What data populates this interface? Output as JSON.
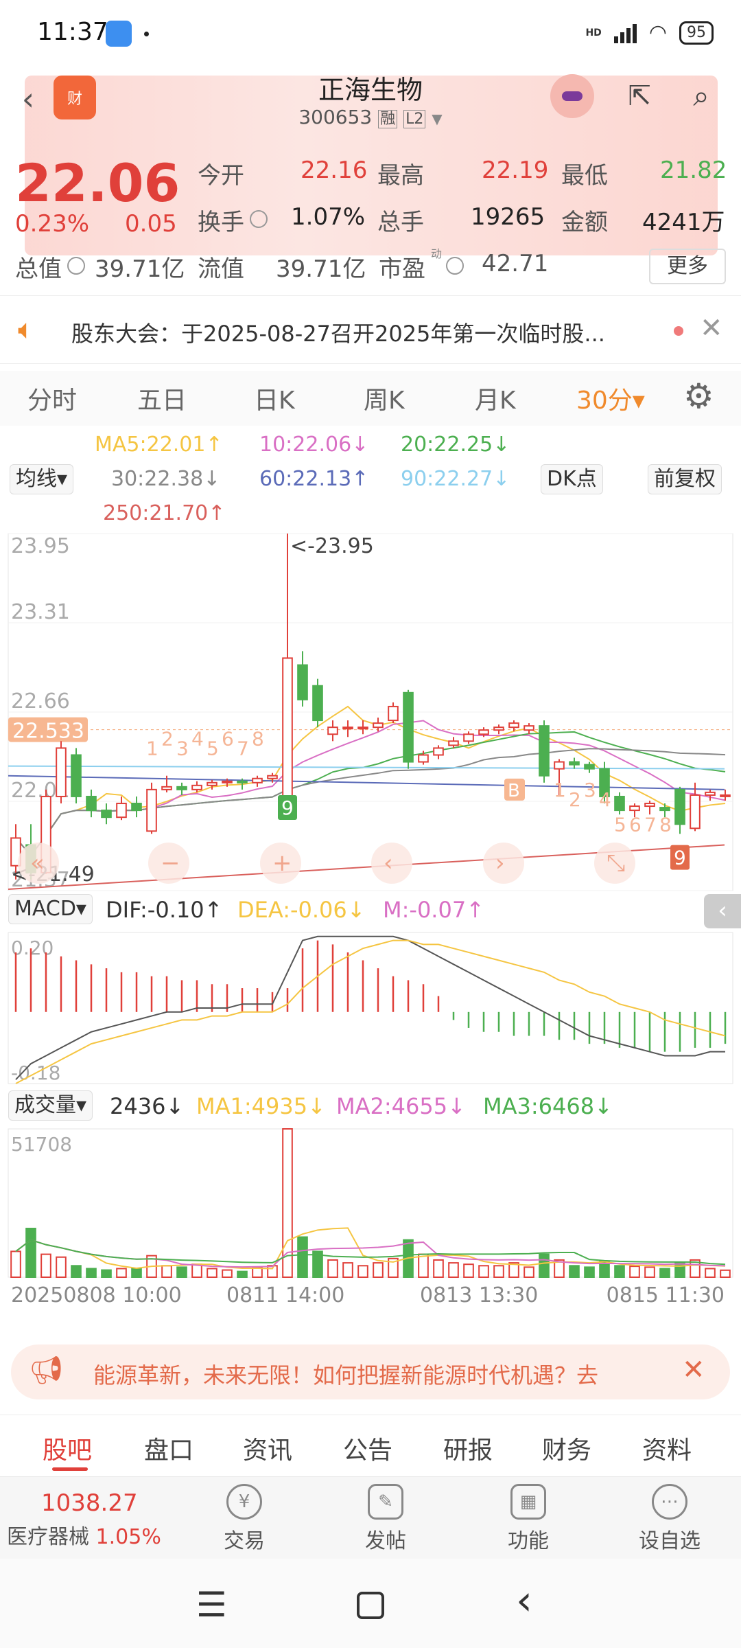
{
  "status": {
    "time": "11:37",
    "battery": "95",
    "network": "HD"
  },
  "header": {
    "title": "正海生物",
    "code": "300653",
    "tag1": "融",
    "tag2": "L2"
  },
  "quote": {
    "price": "22.06",
    "pct": "0.23%",
    "chg": "0.05",
    "open_label": "今开",
    "open": "22.16",
    "high_label": "最高",
    "high": "22.19",
    "low_label": "最低",
    "low": "21.82",
    "turnover_label": "换手",
    "turnover": "1.07%",
    "volume_label": "总手",
    "volume": "19265",
    "amount_label": "金额",
    "amount": "4241万",
    "mktcap_label": "总值",
    "mktcap": "39.71亿",
    "float_label": "流值",
    "float": "39.71亿",
    "pe_label": "市盈",
    "pe_sup": "动",
    "pe": "42.71",
    "more": "更多"
  },
  "notice": {
    "text": "股东大会：于2025-08-27召开2025年第一次临时股..."
  },
  "tabs": [
    {
      "label": "分时"
    },
    {
      "label": "五日"
    },
    {
      "label": "日K"
    },
    {
      "label": "周K"
    },
    {
      "label": "月K"
    },
    {
      "label": "30分▾"
    }
  ],
  "legend": {
    "selector": "均线▾",
    "ma5": "MA5:22.01↑",
    "ma10": "10:22.06↓",
    "ma20": "20:22.25↓",
    "ma30": "30:22.38↓",
    "ma60": "60:22.13↑",
    "ma90": "90:22.27↓",
    "ma250": "250:21.70↑",
    "dk": "DK点",
    "fq": "前复权"
  },
  "colors": {
    "up": "#e0403a",
    "down": "#4caf50",
    "accent": "#f08a2c",
    "ma5": "#f5c542",
    "ma10": "#d96fc4",
    "ma20": "#4caf50",
    "ma30": "#888888",
    "ma60": "#5b6bb8",
    "ma90": "#8ccfee",
    "ma250": "#d9605c"
  },
  "kline": {
    "y_labels": [
      "23.95",
      "23.31",
      "22.66",
      "22.01",
      "21.37"
    ],
    "ylim": [
      21.37,
      23.95
    ],
    "current_price_tag": "22.533",
    "max_label": "<-23.95",
    "min_label": "<-21.49",
    "markers": {
      "b": "B",
      "nine_a": "9",
      "nine_b": "9"
    },
    "seq_a": [
      "1",
      "2",
      "3",
      "4",
      "5",
      "6",
      "7",
      "8"
    ],
    "seq_b": [
      "1",
      "2",
      "3",
      "4",
      "5",
      "6",
      "7",
      "8"
    ],
    "candles": [
      [
        21.55,
        21.75,
        21.45,
        21.85
      ],
      [
        21.7,
        21.5,
        21.45,
        21.85
      ],
      [
        21.5,
        22.05,
        21.49,
        22.1
      ],
      [
        22.05,
        22.4,
        22.0,
        22.45
      ],
      [
        22.35,
        22.05,
        22.0,
        22.4
      ],
      [
        22.05,
        21.95,
        21.9,
        22.1
      ],
      [
        21.95,
        21.9,
        21.85,
        22.0
      ],
      [
        21.9,
        22.0,
        21.88,
        22.05
      ],
      [
        22.0,
        21.95,
        21.9,
        22.05
      ],
      [
        21.8,
        22.1,
        21.78,
        22.15
      ],
      [
        22.1,
        22.12,
        22.08,
        22.2
      ],
      [
        22.12,
        22.1,
        22.06,
        22.15
      ],
      [
        22.1,
        22.13,
        22.08,
        22.16
      ],
      [
        22.13,
        22.15,
        22.1,
        22.17
      ],
      [
        22.15,
        22.16,
        22.12,
        22.18
      ],
      [
        22.16,
        22.15,
        22.1,
        22.18
      ],
      [
        22.15,
        22.18,
        22.12,
        22.2
      ],
      [
        22.18,
        22.2,
        22.15,
        22.22
      ],
      [
        21.95,
        23.05,
        21.95,
        23.95
      ],
      [
        23.0,
        22.75,
        22.7,
        23.1
      ],
      [
        22.85,
        22.6,
        22.55,
        22.9
      ],
      [
        22.5,
        22.55,
        22.45,
        22.6
      ],
      [
        22.55,
        22.55,
        22.48,
        22.6
      ],
      [
        22.55,
        22.55,
        22.5,
        22.6
      ],
      [
        22.55,
        22.58,
        22.52,
        22.62
      ],
      [
        22.6,
        22.7,
        22.58,
        22.73
      ],
      [
        22.8,
        22.3,
        22.25,
        22.82
      ],
      [
        22.3,
        22.35,
        22.28,
        22.38
      ],
      [
        22.35,
        22.4,
        22.32,
        22.42
      ],
      [
        22.42,
        22.45,
        22.4,
        22.48
      ],
      [
        22.45,
        22.5,
        22.43,
        22.52
      ],
      [
        22.5,
        22.53,
        22.48,
        22.55
      ],
      [
        22.53,
        22.55,
        22.5,
        22.57
      ],
      [
        22.55,
        22.58,
        22.52,
        22.6
      ],
      [
        22.53,
        22.56,
        22.5,
        22.58
      ],
      [
        22.56,
        22.2,
        22.15,
        22.6
      ],
      [
        22.25,
        22.3,
        22.05,
        22.32
      ],
      [
        22.3,
        22.28,
        22.25,
        22.33
      ],
      [
        22.28,
        22.25,
        22.22,
        22.3
      ],
      [
        22.25,
        22.05,
        22.0,
        22.3
      ],
      [
        22.05,
        21.95,
        21.92,
        22.08
      ],
      [
        21.95,
        21.98,
        21.9,
        22.0
      ],
      [
        21.98,
        22.0,
        21.92,
        22.02
      ],
      [
        21.97,
        21.95,
        21.9,
        22.0
      ],
      [
        22.1,
        21.85,
        21.78,
        22.12
      ],
      [
        21.82,
        22.06,
        21.8,
        22.15
      ],
      [
        22.06,
        22.08,
        22.02,
        22.1
      ],
      [
        22.06,
        22.06,
        22.02,
        22.1
      ]
    ]
  },
  "macd": {
    "selector": "MACD▾",
    "dif": "DIF:-0.10↑",
    "dea": "DEA:-0.06↓",
    "m": "M:-0.07↑",
    "y_labels": [
      "0.20",
      "-0.18"
    ],
    "ylim": [
      -0.18,
      0.2
    ],
    "hist": [
      0.15,
      0.16,
      0.15,
      0.14,
      0.13,
      0.12,
      0.11,
      0.1,
      0.1,
      0.09,
      0.09,
      0.08,
      0.08,
      0.07,
      0.07,
      0.06,
      0.06,
      0.05,
      0.06,
      0.16,
      0.18,
      0.17,
      0.15,
      0.13,
      0.11,
      0.09,
      0.08,
      0.07,
      0.04,
      -0.02,
      -0.04,
      -0.05,
      -0.05,
      -0.06,
      -0.06,
      -0.06,
      -0.07,
      -0.07,
      -0.08,
      -0.08,
      -0.09,
      -0.09,
      -0.1,
      -0.1,
      -0.1,
      -0.09,
      -0.09,
      -0.08
    ],
    "dif_line": [
      -0.17,
      -0.13,
      -0.11,
      -0.09,
      -0.07,
      -0.05,
      -0.04,
      -0.03,
      -0.02,
      -0.01,
      0.0,
      0.0,
      0.01,
      0.01,
      0.01,
      0.02,
      0.02,
      0.02,
      0.1,
      0.18,
      0.19,
      0.19,
      0.19,
      0.19,
      0.19,
      0.19,
      0.18,
      0.16,
      0.14,
      0.12,
      0.1,
      0.08,
      0.06,
      0.04,
      0.02,
      0.0,
      -0.02,
      -0.04,
      -0.06,
      -0.07,
      -0.08,
      -0.09,
      -0.1,
      -0.11,
      -0.11,
      -0.11,
      -0.1,
      -0.1
    ],
    "dea_line": [
      -0.18,
      -0.16,
      -0.14,
      -0.12,
      -0.1,
      -0.08,
      -0.07,
      -0.06,
      -0.05,
      -0.04,
      -0.03,
      -0.02,
      -0.02,
      -0.01,
      -0.01,
      0.0,
      0.0,
      0.0,
      0.02,
      0.06,
      0.09,
      0.12,
      0.14,
      0.16,
      0.17,
      0.18,
      0.18,
      0.17,
      0.17,
      0.16,
      0.15,
      0.14,
      0.13,
      0.12,
      0.11,
      0.1,
      0.08,
      0.07,
      0.05,
      0.04,
      0.02,
      0.01,
      0.0,
      -0.02,
      -0.03,
      -0.04,
      -0.05,
      -0.06
    ]
  },
  "volume": {
    "selector": "成交量▾",
    "current": "2436↓",
    "ma1": "MA1:4935↓",
    "ma2": "MA2:4655↓",
    "ma3": "MA3:6468↓",
    "y_label": "51708",
    "ymax": 51708,
    "bars": [
      9000,
      17000,
      8000,
      7000,
      4000,
      3000,
      2500,
      3000,
      3000,
      7500,
      4000,
      3500,
      4500,
      3000,
      2500,
      2000,
      3500,
      4000,
      51708,
      14000,
      9000,
      6000,
      5000,
      4000,
      5000,
      6500,
      13000,
      8000,
      6000,
      5000,
      4500,
      4000,
      4000,
      5000,
      3500,
      8000,
      6000,
      4000,
      3500,
      5500,
      4000,
      3800,
      3500,
      3000,
      5000,
      6000,
      3000,
      2436
    ],
    "x_labels": [
      "20250808 10:00",
      "0811 14:00",
      "0813 13:30",
      "0815 11:30"
    ]
  },
  "ad": {
    "text": "能源革新，未来无限！如何把握新能源时代机遇？去"
  },
  "bottom_tabs": [
    {
      "label": "股吧"
    },
    {
      "label": "盘口"
    },
    {
      "label": "资讯"
    },
    {
      "label": "公告"
    },
    {
      "label": "研报"
    },
    {
      "label": "财务"
    },
    {
      "label": "资料"
    }
  ],
  "toolbar": {
    "index_value": "1038.27",
    "index_name": "医疗器械",
    "index_pct": "1.05%",
    "trade": "交易",
    "post": "发帖",
    "func": "功能",
    "watch": "设自选"
  }
}
